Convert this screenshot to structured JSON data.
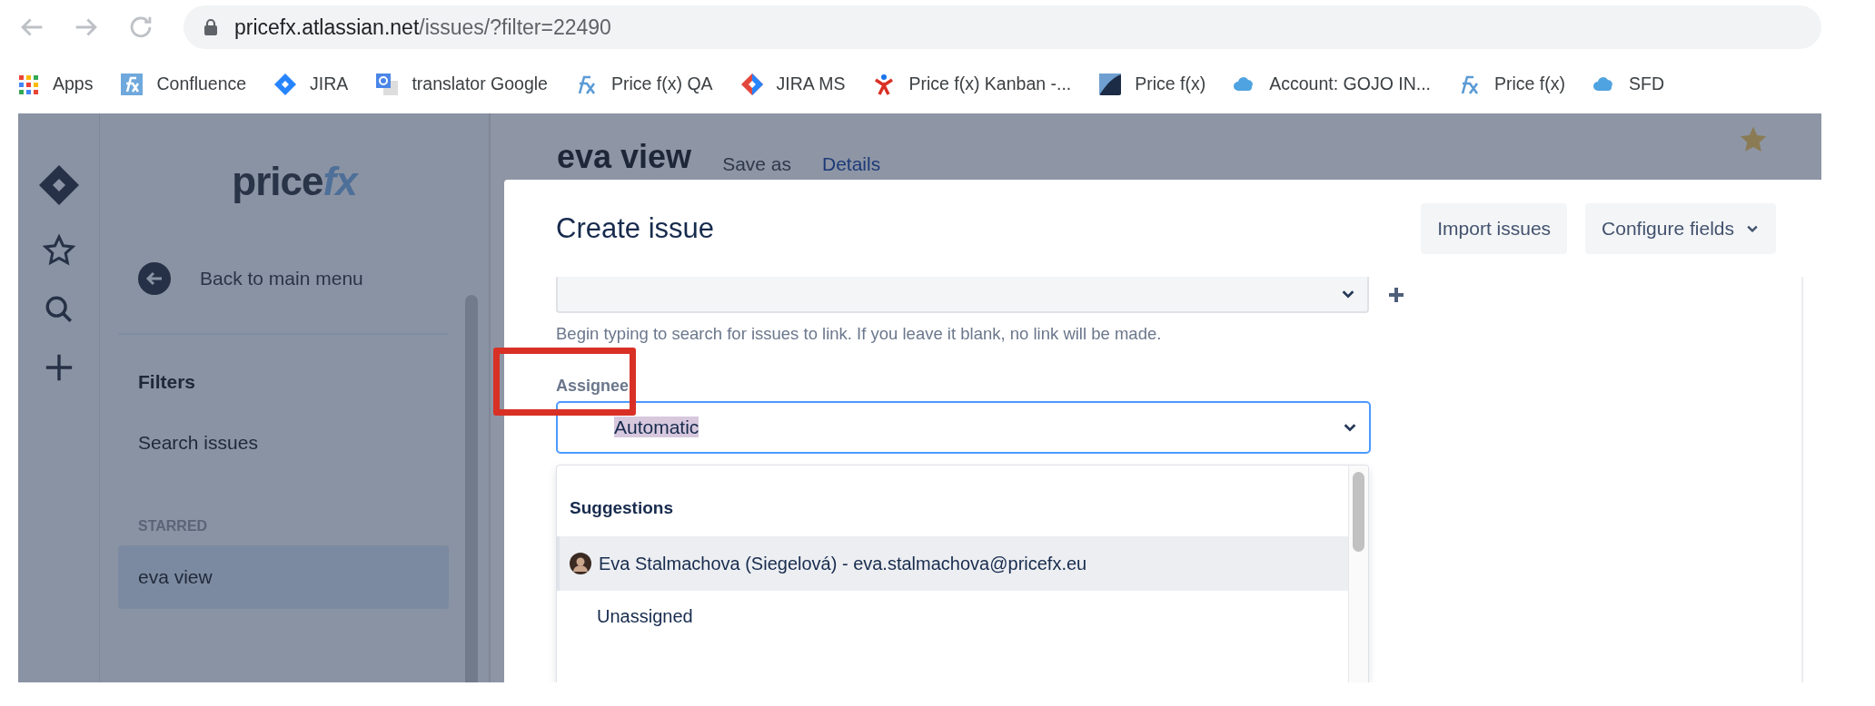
{
  "browser": {
    "url": {
      "host": "pricefx.atlassian.net",
      "path": "/issues/?filter=22490"
    },
    "bookmarks": [
      {
        "label": "Apps",
        "kind": "apps"
      },
      {
        "label": "Confluence",
        "kind": "fx-box"
      },
      {
        "label": "JIRA",
        "kind": "diamond"
      },
      {
        "label": "translator Google",
        "kind": "translate"
      },
      {
        "label": "Price f(x) QA",
        "kind": "fx"
      },
      {
        "label": "JIRA MS",
        "kind": "diamond-red"
      },
      {
        "label": "Price f(x) Kanban -...",
        "kind": "figure"
      },
      {
        "label": "Price f(x)",
        "kind": "swoosh"
      },
      {
        "label": "Account: GOJO IN...",
        "kind": "cloud"
      },
      {
        "label": "Price f(x)",
        "kind": "fx"
      },
      {
        "label": "SFD",
        "kind": "cloud"
      }
    ]
  },
  "sidebar": {
    "logo": {
      "word": "price",
      "mark": "fx"
    },
    "back_link": "Back to main menu",
    "heading": "Filters",
    "items": [
      {
        "label": "Search issues",
        "selected": false
      }
    ],
    "section": "STARRED",
    "starred": [
      {
        "label": "eva view",
        "selected": true
      }
    ]
  },
  "page_header": {
    "title": "eva view",
    "actions": [
      "Save as",
      "Details"
    ]
  },
  "dialog": {
    "title": "Create issue",
    "buttons": [
      {
        "label": "Import issues",
        "kind": "plain"
      },
      {
        "label": "Configure fields",
        "kind": "menu"
      }
    ],
    "linked_issue_help": "Begin typing to search for issues to link. If you leave it blank, no link will be made.",
    "assignee": {
      "label": "Assignee",
      "value": "Automatic",
      "value_selected": true,
      "focused": true
    },
    "annotation": {
      "kind": "rectangle"
    },
    "suggestions": {
      "heading": "Suggestions",
      "options": [
        {
          "label": "Eva Stalmachova (Siegelová) - eva.stalmachova@pricefx.eu",
          "kind": "user",
          "selected": true
        },
        {
          "label": "Unassigned",
          "kind": "plain",
          "selected": false
        }
      ]
    }
  }
}
